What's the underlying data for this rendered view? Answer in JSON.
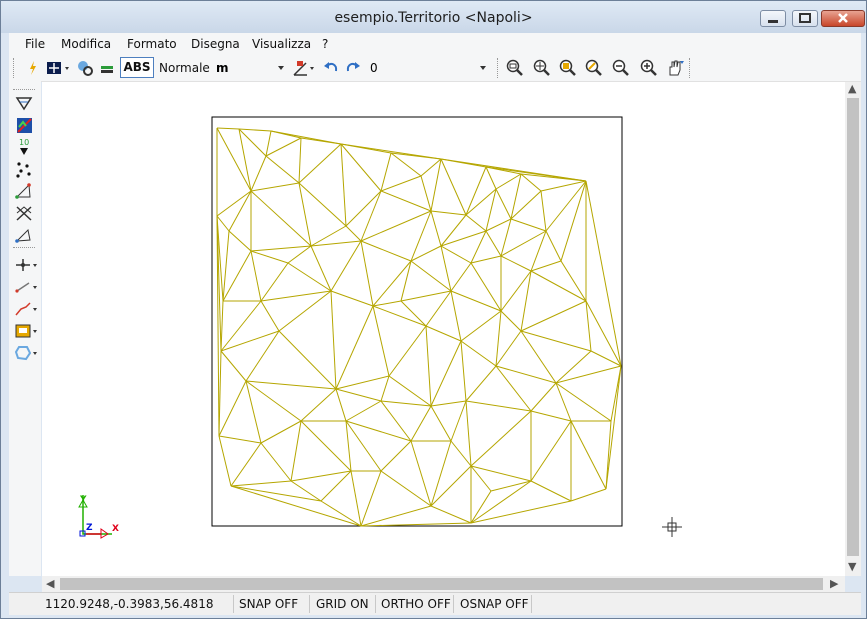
{
  "window": {
    "title": "esempio.Territorio <Napoli>"
  },
  "menu": [
    "File",
    "Modifica",
    "Formato",
    "Disegna",
    "Visualizza",
    "?"
  ],
  "toolbar": {
    "abs_label": "ABS",
    "style_value": "Normale",
    "unit_value": "m",
    "layer_value": "0"
  },
  "status": {
    "coords": "1120.9248,-0.3983,56.4818",
    "snap": "SNAP OFF",
    "grid": "GRID ON",
    "ortho": "ORTHO OFF",
    "osnap": "OSNAP OFF"
  },
  "axes": {
    "y": "Y",
    "z": "Z",
    "x": "X"
  },
  "colors": {
    "mesh": "#b5a600",
    "border": "#000000",
    "axis_x": "#e0001a",
    "axis_y": "#21b000",
    "axis_z": "#0016d8"
  }
}
